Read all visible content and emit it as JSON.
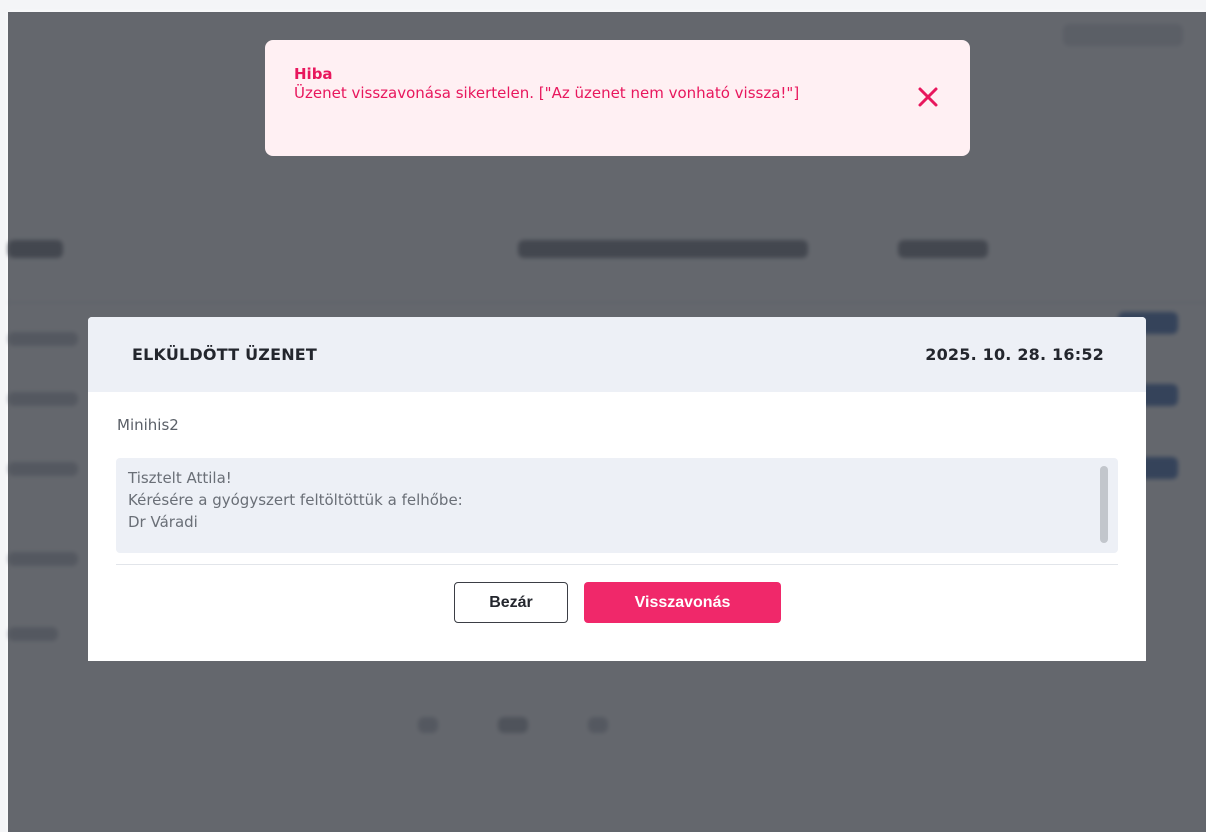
{
  "toast": {
    "title": "Hiba",
    "message": "Üzenet visszavonása sikertelen. [\"Az üzenet nem vonható vissza!\"]",
    "close_icon": "close-icon",
    "color": "#e8175d",
    "background": "#fff0f3"
  },
  "modal": {
    "title": "ELKÜLDÖTT ÜZENET",
    "date": "2025. 10. 28. 16:52",
    "sender": "Minihis2",
    "message_lines": [
      "Tisztelt Attila!",
      "Kérésére a gyógyszert feltöltöttük a felhőbe:",
      "Dr Váradi"
    ],
    "buttons": {
      "close_label": "Bezár",
      "revoke_label": "Visszavonás"
    },
    "accent_color": "#f0286a"
  }
}
